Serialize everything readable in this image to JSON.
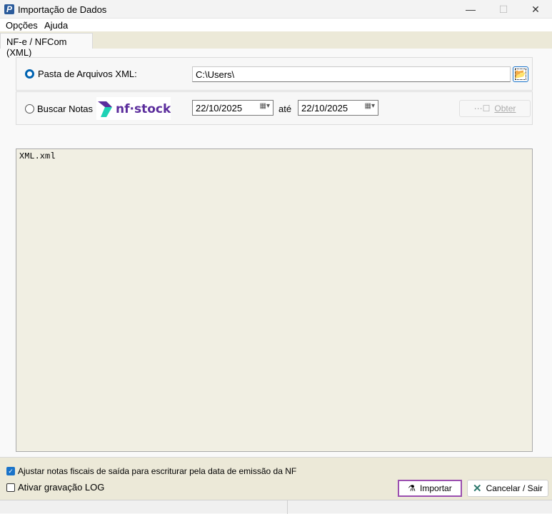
{
  "window": {
    "title": "Importação de Dados",
    "app_icon": "P",
    "minimize": "—",
    "maximize": "☐",
    "close": "✕"
  },
  "menu": [
    "Opções",
    "Ajuda"
  ],
  "tabs": [
    {
      "label": "NF-e / NFCom (XML)",
      "active": true
    }
  ],
  "folder": {
    "label": "Pasta de Arquivos XML:",
    "value": "C:\\Users\\",
    "selected": true
  },
  "search": {
    "label": "Buscar Notas",
    "logo_text": "nf·stock",
    "date_from": "22/10/2025",
    "between": "até",
    "date_to": "22/10/2025",
    "obter_label": "Obter",
    "selected": false
  },
  "memo": {
    "content": "XML.xml"
  },
  "options": {
    "adjust_label": "Ajustar notas fiscais de saída para escriturar pela data de emissão da NF",
    "adjust_checked": true,
    "log_label": "Ativar gravação LOG",
    "log_checked": false
  },
  "buttons": {
    "import": "Importar",
    "cancel": "Cancelar / Sair"
  },
  "colors": {
    "accent": "#0063b1",
    "import_border": "#9b4fb0",
    "logo_purple": "#5b2d9c",
    "logo_teal": "#1ed2b5"
  }
}
